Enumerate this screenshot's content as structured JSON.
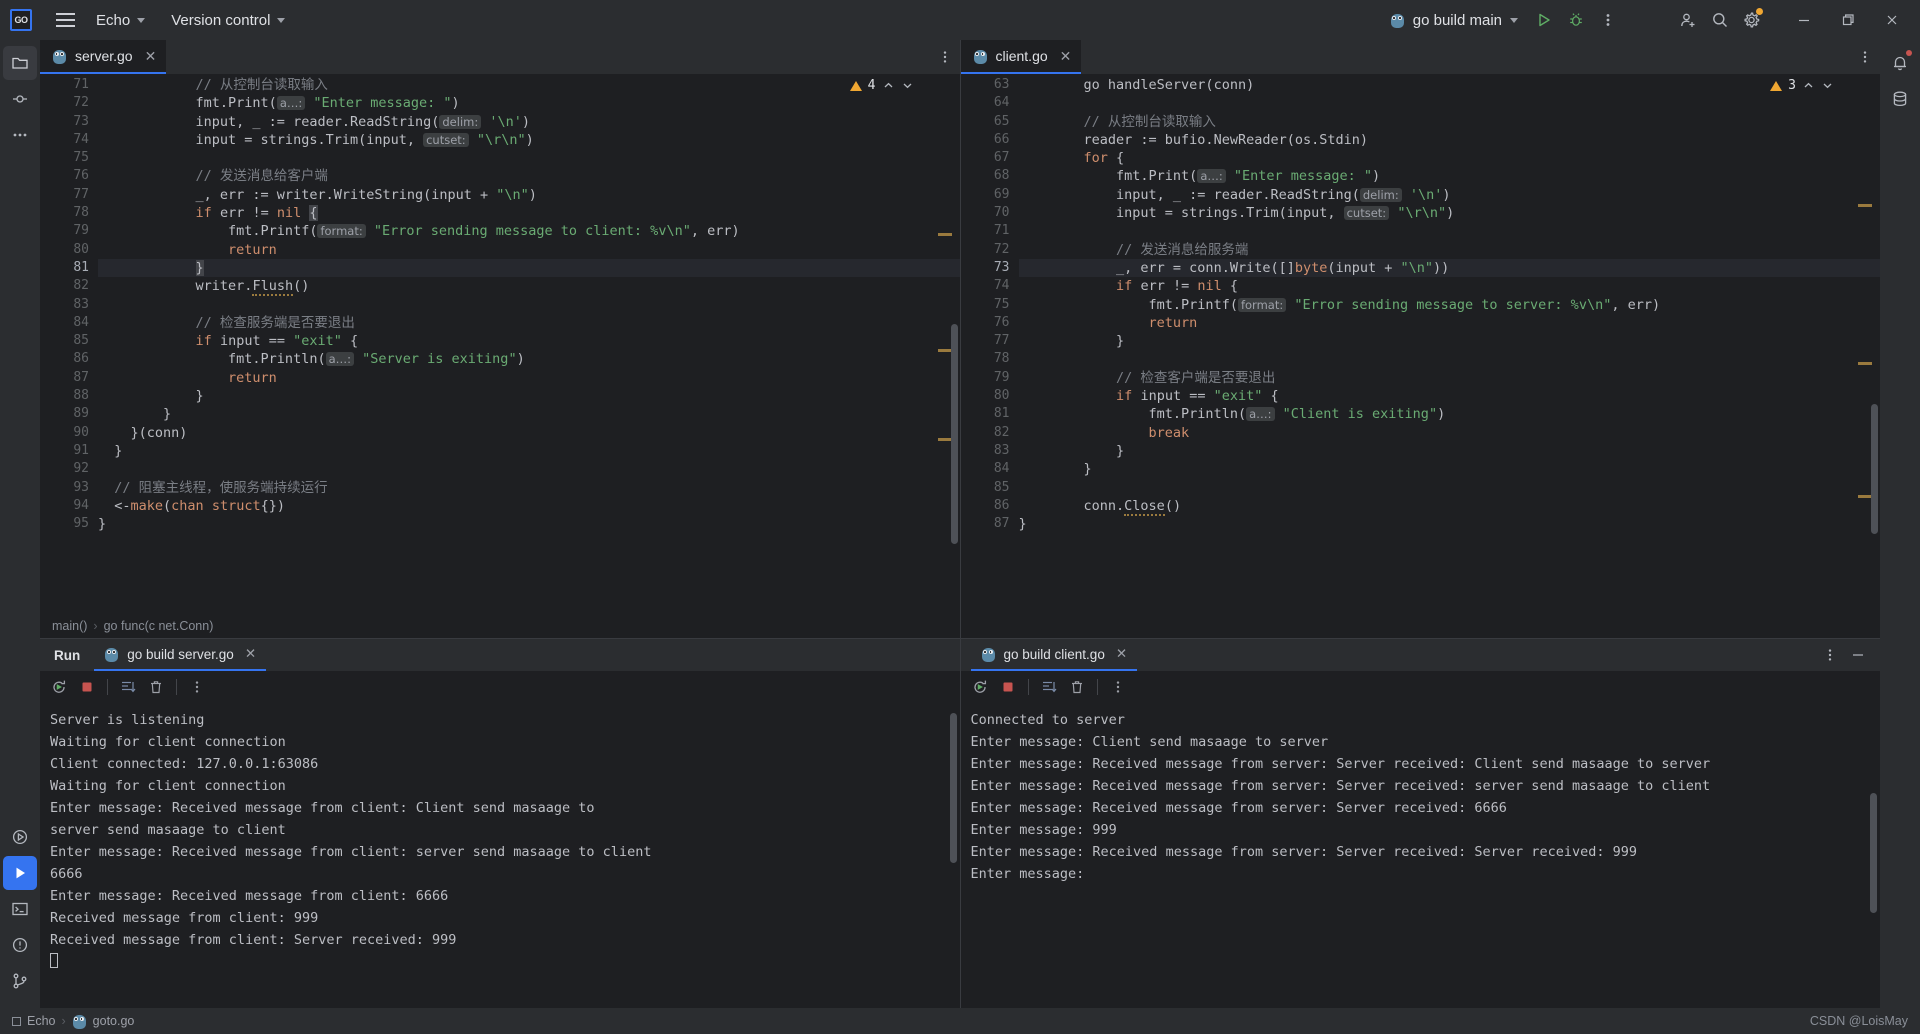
{
  "titlebar": {
    "logo_text": "GO",
    "menu_icon": "hamburger-icon",
    "project_name": "Echo",
    "vcs_label": "Version control",
    "run_config": "go build main",
    "icons": {
      "run": "run-icon",
      "debug": "debug-icon",
      "more": "more-vertical-icon",
      "add_user": "add-user-icon",
      "search": "search-icon",
      "settings": "gear-icon",
      "minimize": "minimize-icon",
      "maximize": "maximize-icon",
      "close": "close-icon"
    }
  },
  "left_rail": {
    "items": [
      {
        "name": "project-icon",
        "glyph": "folder"
      },
      {
        "name": "commit-icon",
        "glyph": "commit"
      },
      {
        "name": "more-tools-icon",
        "glyph": "dots"
      },
      {
        "name": "services-icon",
        "glyph": "play-outline"
      },
      {
        "name": "run-icon",
        "glyph": "play-filled"
      },
      {
        "name": "terminal-icon",
        "glyph": "terminal"
      },
      {
        "name": "problems-icon",
        "glyph": "warning-circle"
      },
      {
        "name": "version-control-icon",
        "glyph": "branch"
      }
    ]
  },
  "right_rail": {
    "items": [
      {
        "name": "notifications-icon",
        "glyph": "bell"
      },
      {
        "name": "database-icon",
        "glyph": "database"
      }
    ]
  },
  "editors": [
    {
      "tab_label": "server.go",
      "tab_icon": "go-file-icon",
      "warning_count": "4",
      "breadcrumb": [
        "main()",
        "go func(c net.Conn)"
      ],
      "first_line_number": 71,
      "current_line": 81,
      "lines": [
        {
          "n": 71,
          "html": "            <span class='cmt'>// 从控制台读取输入</span>"
        },
        {
          "n": 72,
          "html": "            fmt.Print(<span class='hint'>a…:</span> <span class='str'>\"Enter message: \"</span>)"
        },
        {
          "n": 73,
          "html": "            input, _ := reader.ReadString(<span class='hint'>delim:</span> <span class='str'>'\\n'</span>)"
        },
        {
          "n": 74,
          "html": "            input = strings.Trim(input, <span class='hint'>cutset:</span> <span class='str'>\"\\r\\n\"</span>)"
        },
        {
          "n": 75,
          "html": ""
        },
        {
          "n": 76,
          "html": "            <span class='cmt'>// 发送消息给客户端</span>"
        },
        {
          "n": 77,
          "html": "            _, err := writer.WriteString(input + <span class='str'>\"\\n\"</span>)"
        },
        {
          "n": 78,
          "html": "            <span class='kw'>if</span> err != <span class='kw'>nil</span> <span class='curbr'>{</span>"
        },
        {
          "n": 79,
          "html": "                fmt.Printf(<span class='hint'>format:</span> <span class='str'>\"Error sending message to client: %v\\n\"</span>, err)"
        },
        {
          "n": 80,
          "html": "                <span class='kw'>return</span>"
        },
        {
          "n": 81,
          "html": "            <span class='curbr'>}</span>"
        },
        {
          "n": 82,
          "html": "            writer.<span class='wav'>Flush</span>()"
        },
        {
          "n": 83,
          "html": ""
        },
        {
          "n": 84,
          "html": "            <span class='cmt'>// 检查服务端是否要退出</span>"
        },
        {
          "n": 85,
          "html": "            <span class='kw'>if</span> input == <span class='str'>\"exit\"</span> {"
        },
        {
          "n": 86,
          "html": "                fmt.Println(<span class='hint'>a…:</span> <span class='str'>\"Server is exiting\"</span>)"
        },
        {
          "n": 87,
          "html": "                <span class='kw'>return</span>"
        },
        {
          "n": 88,
          "html": "            }"
        },
        {
          "n": 89,
          "html": "        }"
        },
        {
          "n": 90,
          "html": "    }(conn)"
        },
        {
          "n": 91,
          "html": "  }"
        },
        {
          "n": 92,
          "html": ""
        },
        {
          "n": 93,
          "html": "  <span class='cmt'>// 阻塞主线程，使服务端持续运行</span>"
        },
        {
          "n": 94,
          "html": "  &lt;-<span class='kw'>make</span>(<span class='kw'>chan</span> <span class='kw'>struct</span>{})"
        },
        {
          "n": 95,
          "html": "}"
        }
      ]
    },
    {
      "tab_label": "client.go",
      "tab_icon": "go-file-icon",
      "warning_count": "3",
      "breadcrumb": [],
      "first_line_number": 63,
      "current_line": 73,
      "lines": [
        {
          "n": 63,
          "html": "        go handleServer(conn)"
        },
        {
          "n": 64,
          "html": ""
        },
        {
          "n": 65,
          "html": "        <span class='cmt'>// 从控制台读取输入</span>"
        },
        {
          "n": 66,
          "html": "        reader := bufio.NewReader(os.Stdin)"
        },
        {
          "n": 67,
          "html": "        <span class='kw'>for</span> {"
        },
        {
          "n": 68,
          "html": "            fmt.Print(<span class='hint'>a…:</span> <span class='str'>\"Enter message: \"</span>)"
        },
        {
          "n": 69,
          "html": "            input, _ := reader.ReadString(<span class='hint'>delim:</span> <span class='str'>'\\n'</span>)"
        },
        {
          "n": 70,
          "html": "            input = strings.Trim(input, <span class='hint'>cutset:</span> <span class='str'>\"\\r\\n\"</span>)"
        },
        {
          "n": 71,
          "html": ""
        },
        {
          "n": 72,
          "html": "            <span class='cmt'>// 发送消息给服务端</span>"
        },
        {
          "n": 73,
          "html": "            _, err = conn.Write([]<span class='kw'>byte</span>(input + <span class='str'>\"\\n\"</span>))"
        },
        {
          "n": 74,
          "html": "            <span class='kw'>if</span> err != <span class='kw'>nil</span> {"
        },
        {
          "n": 75,
          "html": "                fmt.Printf(<span class='hint'>format:</span> <span class='str'>\"Error sending message to server: %v\\n\"</span>, err)"
        },
        {
          "n": 76,
          "html": "                <span class='kw'>return</span>"
        },
        {
          "n": 77,
          "html": "            }"
        },
        {
          "n": 78,
          "html": ""
        },
        {
          "n": 79,
          "html": "            <span class='cmt'>// 检查客户端是否要退出</span>"
        },
        {
          "n": 80,
          "html": "            <span class='kw'>if</span> input == <span class='str'>\"exit\"</span> {"
        },
        {
          "n": 81,
          "html": "                fmt.Println(<span class='hint'>a…:</span> <span class='str'>\"Client is exiting\"</span>)"
        },
        {
          "n": 82,
          "html": "                <span class='kw'>break</span>"
        },
        {
          "n": 83,
          "html": "            }"
        },
        {
          "n": 84,
          "html": "        }"
        },
        {
          "n": 85,
          "html": ""
        },
        {
          "n": 86,
          "html": "        conn.<span class='wav'>Close</span>()"
        },
        {
          "n": 87,
          "html": "}"
        }
      ]
    }
  ],
  "run_panels": [
    {
      "title": "Run",
      "tab_label": "go build server.go",
      "tab_icon": "go-run-icon",
      "toolbar_icons": [
        "rerun-icon",
        "stop-icon",
        "scroll-to-end-icon",
        "clear-all-icon",
        "more-vertical-icon"
      ],
      "output": [
        "Server is listening",
        "Waiting for client connection",
        "Client connected: 127.0.0.1:63086",
        "Waiting for client connection",
        "Enter message: Received message from client: Client send masaage to",
        "server send masaage to client",
        "Enter message: Received message from client: server send masaage to client",
        "6666",
        "Enter message: Received message from client: 6666",
        "Received message from client: 999",
        "Received message from client: Server received: 999"
      ],
      "has_caret": true
    },
    {
      "title": "",
      "tab_label": "go build client.go",
      "tab_icon": "go-run-icon",
      "toolbar_icons": [
        "rerun-icon",
        "stop-icon",
        "scroll-to-end-icon",
        "clear-all-icon",
        "more-vertical-icon"
      ],
      "header_icons": [
        "more-vertical-icon",
        "hide-icon"
      ],
      "output": [
        "Connected to server",
        "Enter message: Client send masaage to server",
        "Enter message: Received message from server: Server received: Client send masaage to server",
        "Enter message: Received message from server: Server received: server send masaage to client",
        "Enter message: Received message from server: Server received: 6666",
        "Enter message: 999",
        "Enter message: Received message from server: Server received: Server received: 999",
        "Enter message:"
      ],
      "has_caret": false
    }
  ],
  "statusbar": {
    "project": "Echo",
    "file": "goto.go",
    "watermark": "CSDN @LoisMay"
  },
  "colors": {
    "accent": "#3574f0",
    "warning": "#f0a732",
    "string": "#6aab73",
    "keyword": "#cf8e6d",
    "comment": "#7a7e85",
    "bg_editor": "#1e1f22",
    "bg_chrome": "#2b2d30"
  }
}
